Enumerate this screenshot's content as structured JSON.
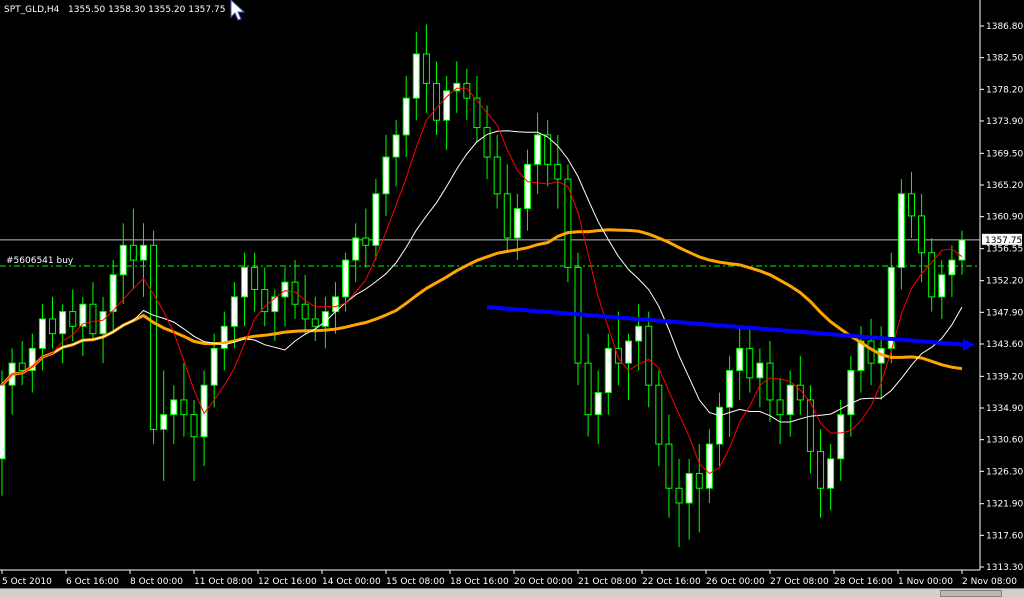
{
  "header": {
    "symbol": "SPT_GLD,H4",
    "ohlc": "1355.50 1358.30 1355.20 1357.75"
  },
  "order_label": "#5606541 buy",
  "current_price_label": "1357.75",
  "price_axis": {
    "min": 1313.3,
    "max": 1386.8,
    "ticks": [
      "1386.80",
      "1382.50",
      "1378.20",
      "1373.90",
      "1369.50",
      "1365.20",
      "1360.90",
      "1356.55",
      "1352.20",
      "1347.90",
      "1343.60",
      "1339.20",
      "1334.90",
      "1330.60",
      "1326.30",
      "1321.90",
      "1317.60",
      "1313.30"
    ]
  },
  "time_axis": {
    "labels": [
      "5 Oct 2010",
      "6 Oct 16:00",
      "8 Oct 00:00",
      "11 Oct 08:00",
      "12 Oct 16:00",
      "14 Oct 00:00",
      "15 Oct 08:00",
      "18 Oct 16:00",
      "20 Oct 00:00",
      "21 Oct 08:00",
      "22 Oct 16:00",
      "26 Oct 00:00",
      "27 Oct 08:00",
      "28 Oct 16:00",
      "1 Nov 00:00",
      "2 Nov 08:00"
    ]
  },
  "colors": {
    "background": "#000000",
    "candle": "#00ff00",
    "bull_body": "#ffffff",
    "bear_body": "#000000",
    "ma_fast": "#ff0000",
    "ma_mid": "#ffffff",
    "ma_slow": "#ffa500",
    "trendline": "#0000ff",
    "order_line": "#00ff00",
    "bid_line": "#c0c0c0"
  },
  "icons": {
    "cursor": "mouse-pointer-icon"
  },
  "chart_data": {
    "type": "candlestick",
    "order_price": 1354.2,
    "bid_price": 1357.75,
    "candles": [
      [
        1328,
        1340,
        1323,
        1338
      ],
      [
        1338,
        1343,
        1334,
        1341
      ],
      [
        1341,
        1344,
        1338,
        1340
      ],
      [
        1340,
        1345,
        1337,
        1343
      ],
      [
        1343,
        1349,
        1340,
        1347
      ],
      [
        1347,
        1350,
        1343,
        1345
      ],
      [
        1345,
        1349,
        1341,
        1348
      ],
      [
        1348,
        1351,
        1344,
        1346
      ],
      [
        1346,
        1350,
        1342,
        1349
      ],
      [
        1349,
        1352,
        1344,
        1345
      ],
      [
        1345,
        1350,
        1341,
        1348
      ],
      [
        1348,
        1355,
        1345,
        1353
      ],
      [
        1353,
        1360,
        1349,
        1357
      ],
      [
        1357,
        1362,
        1351,
        1355
      ],
      [
        1355,
        1360,
        1350,
        1357
      ],
      [
        1357,
        1359,
        1330,
        1332
      ],
      [
        1332,
        1340,
        1325,
        1334
      ],
      [
        1334,
        1338,
        1330,
        1336
      ],
      [
        1336,
        1341,
        1331,
        1334
      ],
      [
        1334,
        1336,
        1325,
        1331
      ],
      [
        1331,
        1340,
        1327,
        1338
      ],
      [
        1338,
        1345,
        1335,
        1343
      ],
      [
        1343,
        1348,
        1340,
        1346
      ],
      [
        1346,
        1352,
        1343,
        1350
      ],
      [
        1350,
        1356,
        1346,
        1354
      ],
      [
        1354,
        1356,
        1348,
        1351
      ],
      [
        1351,
        1354,
        1346,
        1348
      ],
      [
        1348,
        1351,
        1344,
        1350
      ],
      [
        1350,
        1354,
        1346,
        1352
      ],
      [
        1352,
        1355,
        1347,
        1349
      ],
      [
        1349,
        1353,
        1345,
        1347
      ],
      [
        1347,
        1350,
        1344,
        1346
      ],
      [
        1346,
        1350,
        1343,
        1348
      ],
      [
        1348,
        1352,
        1345,
        1350
      ],
      [
        1350,
        1356,
        1348,
        1355
      ],
      [
        1355,
        1360,
        1352,
        1358
      ],
      [
        1358,
        1362,
        1354,
        1357
      ],
      [
        1357,
        1366,
        1355,
        1364
      ],
      [
        1364,
        1372,
        1361,
        1369
      ],
      [
        1369,
        1374,
        1365,
        1372
      ],
      [
        1372,
        1380,
        1369,
        1377
      ],
      [
        1377,
        1386,
        1374,
        1383
      ],
      [
        1383,
        1387,
        1375,
        1379
      ],
      [
        1379,
        1382,
        1372,
        1374
      ],
      [
        1374,
        1380,
        1370,
        1378
      ],
      [
        1378,
        1382,
        1375,
        1379
      ],
      [
        1379,
        1381,
        1374,
        1377
      ],
      [
        1377,
        1380,
        1371,
        1373
      ],
      [
        1373,
        1376,
        1366,
        1369
      ],
      [
        1369,
        1372,
        1362,
        1364
      ],
      [
        1364,
        1368,
        1356,
        1358
      ],
      [
        1358,
        1364,
        1355,
        1362
      ],
      [
        1362,
        1370,
        1359,
        1368
      ],
      [
        1368,
        1375,
        1364,
        1372
      ],
      [
        1372,
        1374,
        1365,
        1368
      ],
      [
        1368,
        1372,
        1362,
        1366
      ],
      [
        1366,
        1368,
        1352,
        1354
      ],
      [
        1354,
        1356,
        1338,
        1341
      ],
      [
        1341,
        1345,
        1331,
        1334
      ],
      [
        1334,
        1340,
        1330,
        1337
      ],
      [
        1337,
        1345,
        1334,
        1343
      ],
      [
        1343,
        1348,
        1338,
        1341
      ],
      [
        1341,
        1345,
        1336,
        1344
      ],
      [
        1344,
        1349,
        1340,
        1346
      ],
      [
        1346,
        1348,
        1335,
        1338
      ],
      [
        1338,
        1340,
        1327,
        1330
      ],
      [
        1330,
        1334,
        1320,
        1324
      ],
      [
        1324,
        1328,
        1316,
        1322
      ],
      [
        1322,
        1328,
        1317,
        1326
      ],
      [
        1326,
        1330,
        1318,
        1324
      ],
      [
        1324,
        1332,
        1322,
        1330
      ],
      [
        1330,
        1337,
        1327,
        1335
      ],
      [
        1335,
        1342,
        1331,
        1340
      ],
      [
        1340,
        1346,
        1336,
        1343
      ],
      [
        1343,
        1346,
        1337,
        1339
      ],
      [
        1339,
        1343,
        1335,
        1341
      ],
      [
        1341,
        1344,
        1333,
        1336
      ],
      [
        1336,
        1339,
        1330,
        1334
      ],
      [
        1334,
        1340,
        1331,
        1338
      ],
      [
        1338,
        1342,
        1334,
        1336
      ],
      [
        1336,
        1338,
        1326,
        1329
      ],
      [
        1329,
        1332,
        1320,
        1324
      ],
      [
        1324,
        1330,
        1321,
        1328
      ],
      [
        1328,
        1336,
        1325,
        1334
      ],
      [
        1334,
        1342,
        1331,
        1340
      ],
      [
        1340,
        1346,
        1337,
        1344
      ],
      [
        1344,
        1347,
        1338,
        1341
      ],
      [
        1341,
        1346,
        1336,
        1343
      ],
      [
        1343,
        1356,
        1341,
        1354
      ],
      [
        1354,
        1366,
        1351,
        1364
      ],
      [
        1364,
        1367,
        1358,
        1361
      ],
      [
        1361,
        1364,
        1352,
        1356
      ],
      [
        1356,
        1358,
        1348,
        1350
      ],
      [
        1350,
        1355,
        1347,
        1353
      ],
      [
        1353,
        1357,
        1350,
        1355
      ],
      [
        1355,
        1359,
        1353,
        1357.75
      ]
    ],
    "trendline": {
      "from": 1348.6,
      "to": 1343.5
    }
  }
}
